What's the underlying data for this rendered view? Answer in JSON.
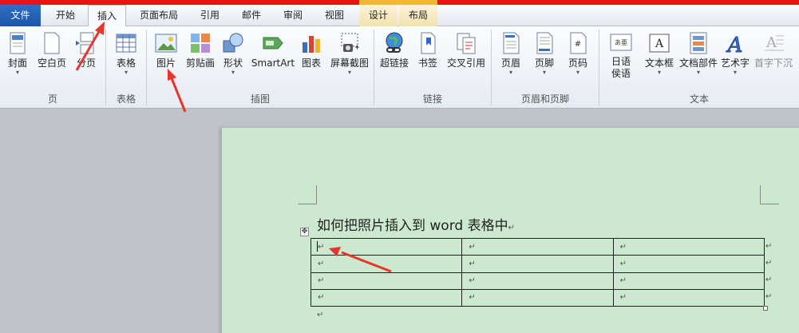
{
  "tabs": [
    {
      "label": "文件"
    },
    {
      "label": "开始"
    },
    {
      "label": "插入"
    },
    {
      "label": "页面布局"
    },
    {
      "label": "引用"
    },
    {
      "label": "邮件"
    },
    {
      "label": "审阅"
    },
    {
      "label": "视图"
    },
    {
      "label": "设计"
    },
    {
      "label": "布局"
    }
  ],
  "ribbon": {
    "groups": [
      {
        "label": "页"
      },
      {
        "label": "表格"
      },
      {
        "label": "插图"
      },
      {
        "label": "链接"
      },
      {
        "label": "页眉和页脚"
      },
      {
        "label": "文本"
      }
    ],
    "buttons": [
      {
        "label": "封面",
        "icon": "cover-page-icon"
      },
      {
        "label": "空白页",
        "icon": "blank-page-icon"
      },
      {
        "label": "分页",
        "icon": "page-break-icon"
      },
      {
        "label": "表格",
        "icon": "table-icon"
      },
      {
        "label": "图片",
        "icon": "picture-icon"
      },
      {
        "label": "剪贴画",
        "icon": "clip-art-icon"
      },
      {
        "label": "形状",
        "icon": "shapes-icon"
      },
      {
        "label": "SmartArt",
        "icon": "smartart-icon"
      },
      {
        "label": "图表",
        "icon": "chart-icon"
      },
      {
        "label": "屏幕截图",
        "icon": "screenshot-icon"
      },
      {
        "label": "超链接",
        "icon": "hyperlink-icon"
      },
      {
        "label": "书签",
        "icon": "bookmark-icon"
      },
      {
        "label": "交叉引用",
        "icon": "cross-reference-icon"
      },
      {
        "label": "页眉",
        "icon": "header-icon"
      },
      {
        "label": "页脚",
        "icon": "footer-icon"
      },
      {
        "label": "页码",
        "icon": "page-number-icon"
      },
      {
        "label": "日语",
        "label2": "侯语",
        "icon": "japanese-phonetic-icon"
      },
      {
        "label": "文本框",
        "icon": "text-box-icon"
      },
      {
        "label": "文档部件",
        "icon": "quick-parts-icon"
      },
      {
        "label": "艺术字",
        "icon": "wordart-icon"
      },
      {
        "label": "首字下沉",
        "icon": "drop-cap-icon"
      }
    ]
  },
  "document": {
    "heading": "如何把照片插入到 word 表格中",
    "mark": "↵"
  },
  "colors": {
    "accent_red": "#e11111",
    "file_tab": "#1d55a8",
    "page_bg": "#cce8cf",
    "arrow": "#e8352b"
  }
}
